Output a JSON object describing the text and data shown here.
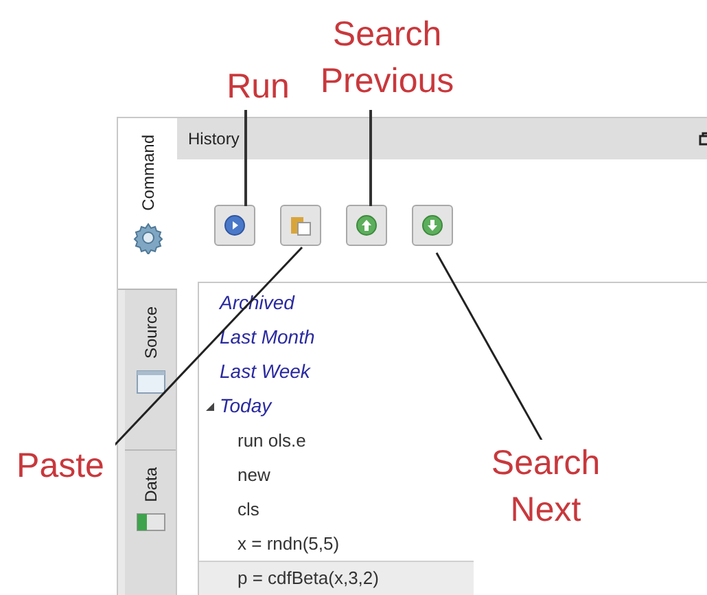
{
  "annotations": [
    {
      "text": "Run",
      "kind": "run"
    },
    {
      "text": "Search Previous",
      "kind": "previous"
    },
    {
      "text": "Paste",
      "kind": "paste"
    },
    {
      "text": "Search Next",
      "kind": "next"
    }
  ],
  "side_tabs": [
    {
      "label": "Command",
      "kind": "gear",
      "selected": true
    },
    {
      "label": "Source",
      "kind": "window",
      "selected": false
    },
    {
      "label": "Data",
      "kind": "sheet",
      "selected": false
    }
  ],
  "panel": {
    "title": "History"
  },
  "toolbar": [
    {
      "kind": "run"
    },
    {
      "kind": "paste"
    },
    {
      "kind": "up"
    },
    {
      "kind": "down"
    }
  ],
  "history": [
    {
      "label": "Archived",
      "expanded": false
    },
    {
      "label": "Last Month",
      "expanded": false
    },
    {
      "label": "Last Week",
      "expanded": false
    },
    {
      "label": "Today",
      "expanded": true,
      "children": [
        {
          "label": "run ols.e",
          "selected": false
        },
        {
          "label": "new",
          "selected": false
        },
        {
          "label": "cls",
          "selected": false
        },
        {
          "label": "x = rndn(5,5)",
          "selected": false
        },
        {
          "label": "p = cdfBeta(x,3,2)",
          "selected": true
        }
      ]
    }
  ]
}
